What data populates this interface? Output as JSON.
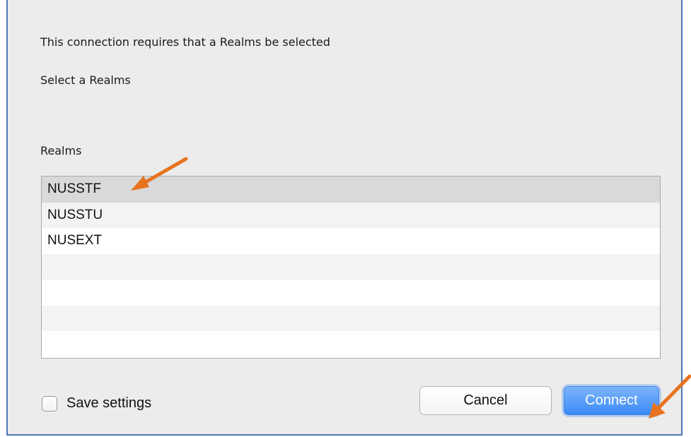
{
  "dialog": {
    "message": "This connection requires that a Realms be selected",
    "prompt": "Select a Realms",
    "list_label": "Realms"
  },
  "realms": {
    "items": [
      "NUSSTF",
      "NUSSTU",
      "NUSEXT",
      "",
      "",
      "",
      ""
    ],
    "selected_index": 0
  },
  "save_settings": {
    "label": "Save settings",
    "checked": false
  },
  "buttons": {
    "cancel_label": "Cancel",
    "connect_label": "Connect"
  },
  "colors": {
    "annotation_arrow": "#e8731f",
    "default_button": "#3a8bf6",
    "selected_row": "#d9d9d9",
    "dialog_border": "#4a78b8"
  }
}
